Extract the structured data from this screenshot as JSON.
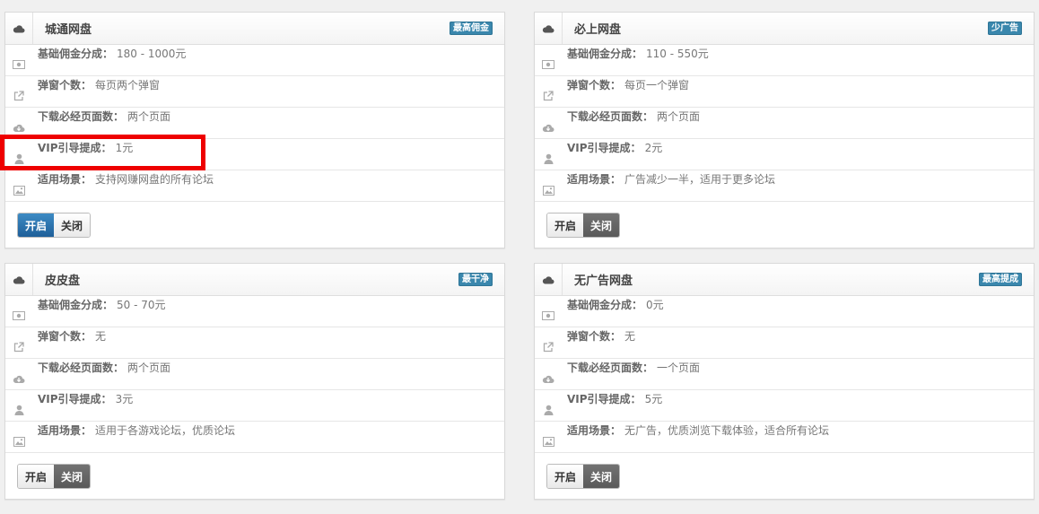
{
  "colors": {
    "accent": "#3a87ad",
    "highlight": "#e00000",
    "toggle_on": "#2a6fae",
    "toggle_off": "#666666"
  },
  "labels": {
    "base_commission": "基础佣金分成：",
    "popups": "弹窗个数：",
    "pages": "下载必经页面数：",
    "vip": "VIP引导提成：",
    "scene": "适用场景："
  },
  "toggle": {
    "on": "开启",
    "off": "关闭"
  },
  "cards": [
    {
      "title": "城通网盘",
      "badge": "最高佣金",
      "base_commission": "180 - 1000元",
      "popups": "每页两个弹窗",
      "pages": "两个页面",
      "vip": "1元",
      "scene": "支持网赚网盘的所有论坛",
      "state": "on"
    },
    {
      "title": "必上网盘",
      "badge": "少广告",
      "base_commission": "110 - 550元",
      "popups": "每页一个弹窗",
      "pages": "两个页面",
      "vip": "2元",
      "scene": "广告减少一半，适用于更多论坛",
      "state": "off"
    },
    {
      "title": "皮皮盘",
      "badge": "最干净",
      "base_commission": "50 - 70元",
      "popups": "无",
      "pages": "两个页面",
      "vip": "3元",
      "scene": "适用于各游戏论坛，优质论坛",
      "state": "off"
    },
    {
      "title": "无广告网盘",
      "badge": "最高提成",
      "base_commission": "0元",
      "popups": "无",
      "pages": "一个页面",
      "vip": "5元",
      "scene": "无广告，优质浏览下载体验，适合所有论坛",
      "state": "off"
    }
  ]
}
